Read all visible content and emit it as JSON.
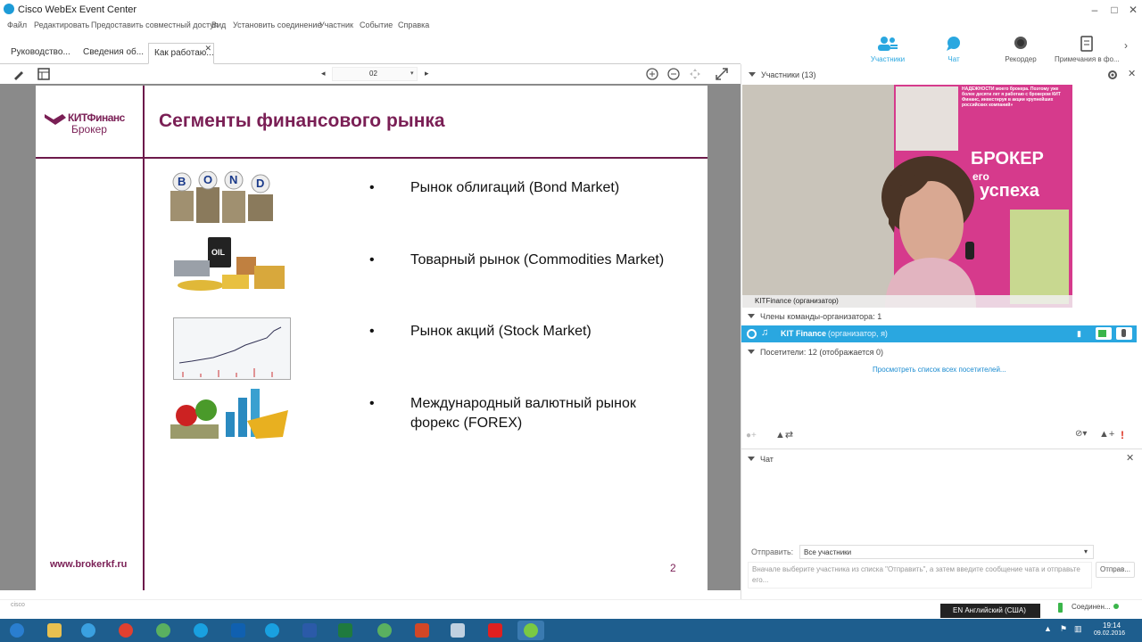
{
  "window": {
    "title": "Cisco WebEx Event Center"
  },
  "menu": [
    "Файл",
    "Редактировать",
    "Предоставить совместный доступ",
    "Вид",
    "Установить соединение",
    "Участник",
    "Событие",
    "Справка"
  ],
  "tabs": [
    {
      "label": "Руководство..."
    },
    {
      "label": "Сведения об..."
    },
    {
      "label": "Как работаю...",
      "active": true
    }
  ],
  "top_buttons": [
    {
      "label": "Участники",
      "icon": "participants-icon"
    },
    {
      "label": "Чат",
      "icon": "chat-icon"
    },
    {
      "label": "Рекордер",
      "icon": "recorder-icon"
    },
    {
      "label": "Примечания в фо...",
      "icon": "notes-icon"
    }
  ],
  "toolbar": {
    "page_value": "02"
  },
  "slide": {
    "logo_line1": "КИТФинанс",
    "logo_line2": "Брокер",
    "title": "Сегменты финансового рынка",
    "bullets": [
      {
        "text": "Рынок облигаций (Bond Market)"
      },
      {
        "text": "Товарный рынок (Commodities Market)"
      },
      {
        "text": "Рынок акций (Stock Market)"
      },
      {
        "text": "Международный валютный рынок форекс (FOREX)"
      }
    ],
    "bond_letters": [
      "B",
      "O",
      "N",
      "D"
    ],
    "oil_label": "OIL",
    "url": "www.brokerkf.ru",
    "page_number": "2"
  },
  "participants_panel": {
    "header": "Участники (13)",
    "video_caption": "KITFinance (организатор)",
    "poster_text_top": "НАДЕЖНОСТИ моего брокера. Поэтому уже более десяти лет я работаю с брокером КИТ Финанс, инвестируя в акции крупнейших российских компаний»",
    "poster_broker": "БРОКЕР",
    "poster_mid": "его",
    "poster_success": "успеха",
    "team_header": "Члены команды-организатора: 1",
    "host_name": "KIT Finance",
    "host_role": "(организатор, я)",
    "visitors_header": "Посетители: 12 (отображается 0)",
    "view_all_link": "Просмотреть список всех посетителей..."
  },
  "chat_panel": {
    "header": "Чат",
    "send_label": "Отправить:",
    "send_to_value": "Все участники",
    "placeholder": "Вначале выберите участника из списка \"Отправить\", а затем введите сообщение чата и отправьте его...",
    "send_button": "Отправ..."
  },
  "status": {
    "language": "EN Английский (США)",
    "connection": "Соединен...",
    "cisco": "cisco"
  },
  "taskbar": {
    "time": "19:14",
    "date": "09.02.2016"
  },
  "colors": {
    "accent_blue": "#2aa7e0",
    "slide_maroon": "#7a1f55",
    "taskbar": "#1e5e8e"
  }
}
